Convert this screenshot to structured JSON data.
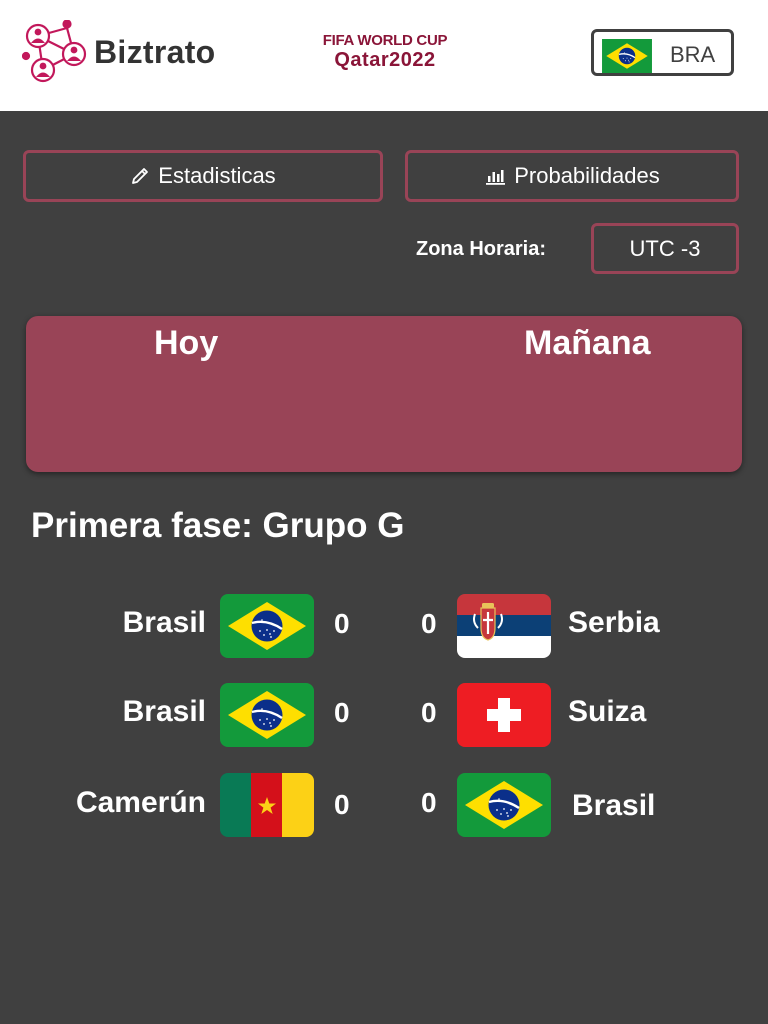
{
  "header": {
    "brand": "Biztrato",
    "event_line1": "FIFA WORLD CUP",
    "event_line2": "Qatar2022",
    "country_code": "BRA",
    "country_flag": "brazil-flag-icon"
  },
  "actions": {
    "stats_label": "Estadisticas",
    "stats_icon": "pencil-icon",
    "prob_label": "Probabilidades",
    "prob_icon": "bar-chart-icon"
  },
  "timezone": {
    "label": "Zona Horaria:",
    "value": "UTC -3"
  },
  "days": {
    "today": "Hoy",
    "tomorrow": "Mañana"
  },
  "phase": {
    "title": "Primera fase: Grupo G"
  },
  "matches": [
    {
      "home": "Brasil",
      "home_flag": "brazil-flag-icon",
      "home_score": "0",
      "away_score": "0",
      "away": "Serbia",
      "away_flag": "serbia-flag-icon"
    },
    {
      "home": "Brasil",
      "home_flag": "brazil-flag-icon",
      "home_score": "0",
      "away_score": "0",
      "away": "Suiza",
      "away_flag": "switzerland-flag-icon"
    },
    {
      "home": "Camerún",
      "home_flag": "cameroon-flag-icon",
      "home_score": "0",
      "away_score": "0",
      "away": "Brasil",
      "away_flag": "brazil-flag-icon"
    }
  ],
  "colors": {
    "accent": "#994457",
    "background": "#404040",
    "brand_maroon": "#8a1538",
    "brand_pink": "#c2185b"
  }
}
